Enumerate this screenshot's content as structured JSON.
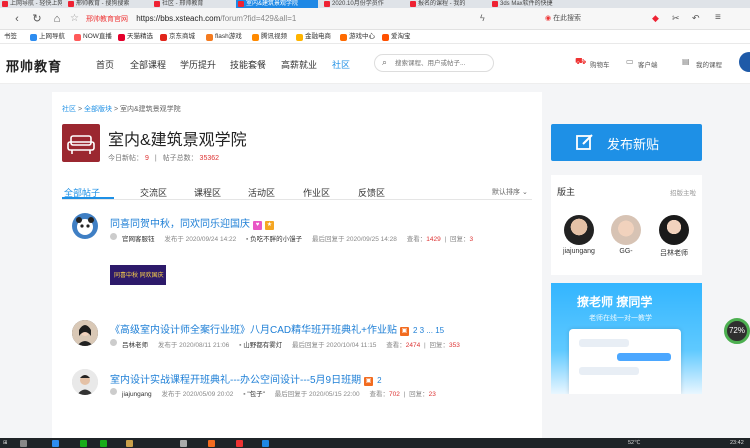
{
  "browser": {
    "tabs": [
      {
        "label": "上网导航 - 轻快上网",
        "active": false
      },
      {
        "label": "邢帅教育 - 搜狗搜索",
        "active": false
      },
      {
        "label": "社区 - 邢帅教育",
        "active": false
      },
      {
        "label": "室内&建筑景观学院",
        "active": true
      },
      {
        "label": "2020.10月份学员作",
        "active": false
      },
      {
        "label": "报名的课程 - 我的",
        "active": false
      },
      {
        "label": "3ds Max软件的快捷",
        "active": false
      }
    ],
    "site_label": "邢帅教育官网",
    "url_host": "https://bbs.xsteach.com",
    "url_path": "/forum?fid=429&all=1",
    "search_hint": "在此搜索"
  },
  "bookmarks": [
    {
      "label": "书签",
      "color": ""
    },
    {
      "label": "上网导航",
      "color": "#2d8cf0"
    },
    {
      "label": "NOW直播",
      "color": "#ff5a5a"
    },
    {
      "label": "天猫精选",
      "color": "#e4002b"
    },
    {
      "label": "京东商城",
      "color": "#e1251b"
    },
    {
      "label": "flash游戏",
      "color": "#f47b20"
    },
    {
      "label": "腾讯视频",
      "color": "#ff8a00"
    },
    {
      "label": "金融电商",
      "color": "#ffb400"
    },
    {
      "label": "游戏中心",
      "color": "#ff6a00"
    },
    {
      "label": "爱淘宝",
      "color": "#ff5000"
    }
  ],
  "site": {
    "logo": "邢帅教育",
    "nav": [
      "首页",
      "全部课程",
      "学历提升",
      "技能套餐",
      "高薪就业",
      "社区"
    ],
    "nav_active": "社区",
    "search_placeholder": "搜索课程、用户或帖子...",
    "cart": "购物车",
    "client": "客户端",
    "my_courses": "我的课程"
  },
  "forum": {
    "breadcrumb": {
      "home": "社区",
      "sep1": ">",
      "all": "全部版块",
      "sep2": ">",
      "current": "室内&建筑景观学院"
    },
    "title": "室内&建筑景观学院",
    "today_label": "今日新帖：",
    "today_count": "9",
    "divider": "|",
    "total_label": "帖子总数：",
    "total_count": "35362",
    "tabs": [
      "全部帖子",
      "交流区",
      "课程区",
      "活动区",
      "作业区",
      "反馈区"
    ],
    "sort": "默认排序"
  },
  "posts": [
    {
      "title": "同喜同贺中秋，同欢同乐迎国庆",
      "author": "官网客服钰",
      "published": "发布于 2020/09/24 14:22",
      "last_by": "负吃不胖的小馒子",
      "last_reply": "最后回复于 2020/09/25 14:28",
      "views_label": "查看：",
      "views": "1429",
      "replies_label": "回复：",
      "replies": "3",
      "pages": ""
    },
    {
      "title": "《高级室内设计师全案行业班》八月CAD精华班开班典礼+作业贴",
      "author": "吕林老师",
      "published": "发布于 2020/08/11 21:06",
      "last_by": "山野都有雾灯",
      "last_reply": "最后回复于 2020/10/04 11:15",
      "views_label": "查看：",
      "views": "2474",
      "replies_label": "回复：",
      "replies": "353",
      "pages": "2 3 ... 15"
    },
    {
      "title": "室内设计实战课程开班典礼---办公空间设计---5月9日班期",
      "author": "jiajungang",
      "published": "发布于 2020/05/09 20:02",
      "last_by": "\"包子\"",
      "last_reply": "最后回复于 2020/05/15 22:00",
      "views_label": "查看：",
      "views": "702",
      "replies_label": "回复：",
      "replies": "23",
      "pages": "2"
    }
  ],
  "banner_text": "同喜中秋 同欢国庆",
  "sidebar": {
    "publish": "发布新贴",
    "moderators_title": "版主",
    "apply": "招版主啦",
    "moderators": [
      "jiajungang",
      "GG-",
      "吕林老师"
    ],
    "promo_title": "撩老师  撩同学",
    "promo_sub": "老师在线一对一教学"
  },
  "float_badge": "72%",
  "taskbar": {
    "temp": "52℃",
    "time": "23:42"
  },
  "colors": {
    "accent": "#1e90e6",
    "red": "#dd3333",
    "forum_icon": "#9b2730"
  }
}
